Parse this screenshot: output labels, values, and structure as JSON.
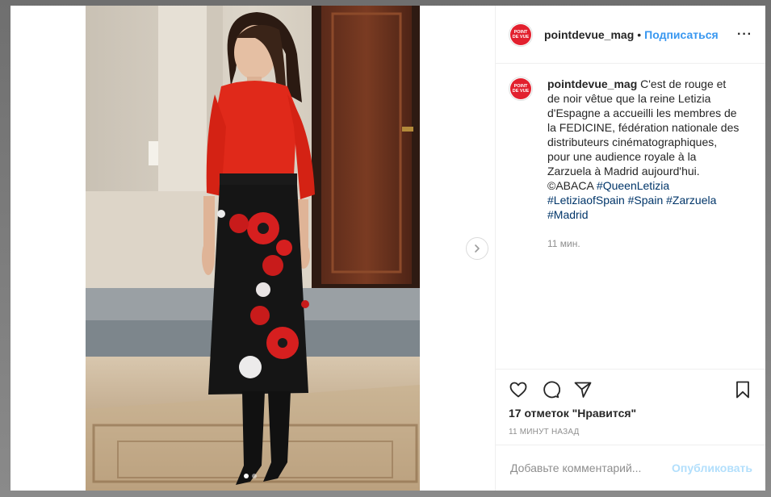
{
  "post": {
    "author": "pointdevue_mag",
    "avatar_text_line1": "POINT",
    "avatar_text_line2": "DE VUE",
    "separator": "•",
    "follow_label": "Подписаться",
    "more_label": "···",
    "caption_text": " C'est de rouge et de noir vêtue que la reine Letizia d'Espagne a accueilli les membres de la FEDICINE, fédération nationale des distributeurs cinématographiques, pour une audience royale à la Zarzuela à Madrid aujourd'hui. ©ABACA ",
    "hashtags": [
      "#QueenLetizia",
      "#LetiziaofSpain",
      "#Spain",
      "#Zarzuela",
      "#Madrid"
    ],
    "caption_time": "11 мин.",
    "likes": "17 отметок \"Нравится\"",
    "date": "11 МИНУТ НАЗАД",
    "comment_placeholder": "Добавьте комментарий...",
    "publish_label": "Опубликовать",
    "carousel": {
      "slides": 2,
      "active": 0
    }
  },
  "colors": {
    "accent": "#3897f0",
    "hashtag": "#003569",
    "brand": "#e2202e"
  },
  "icons": [
    "heart-icon",
    "comment-icon",
    "share-icon",
    "bookmark-icon",
    "chevron-right-icon"
  ]
}
